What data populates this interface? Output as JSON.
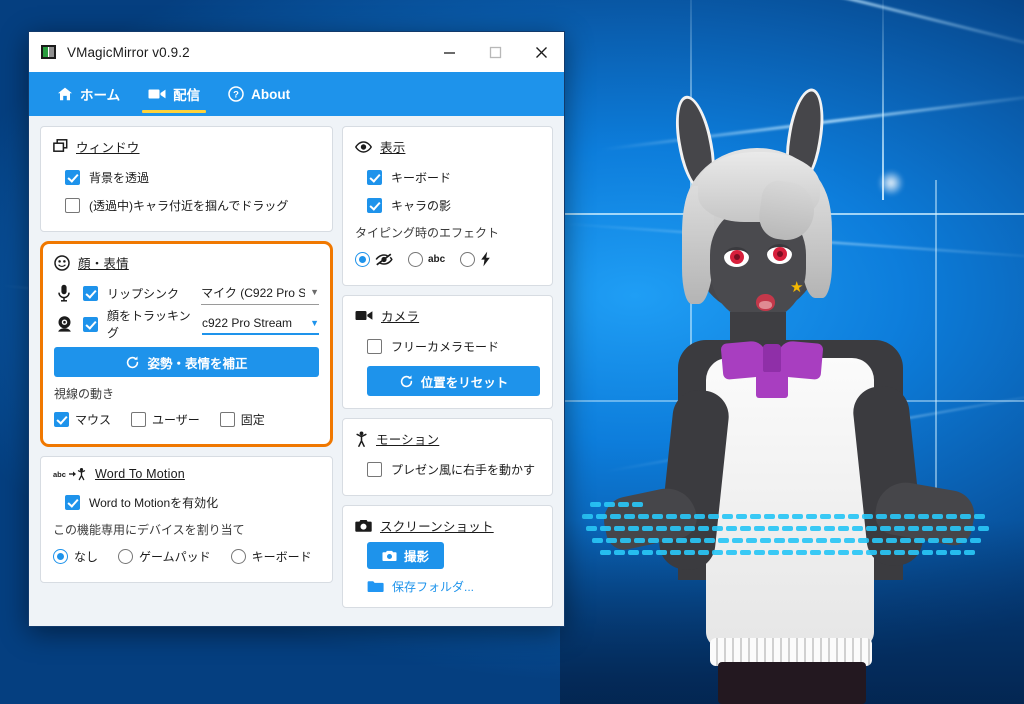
{
  "window": {
    "title": "VMagicMirror v0.9.2",
    "app_icon": "app-icon",
    "minimize_label": "—",
    "maximize_label": "□",
    "close_label": "✕"
  },
  "tabs": [
    {
      "label": "ホーム",
      "icon": "home-icon",
      "active": false
    },
    {
      "label": "配信",
      "icon": "video-camera-icon",
      "active": true
    },
    {
      "label": "About",
      "icon": "question-circle-icon",
      "active": false
    }
  ],
  "left_column": {
    "window_card": {
      "title": "ウィンドウ",
      "icon": "windows-overlap-icon",
      "options": [
        {
          "label": "背景を透過",
          "checked": true
        },
        {
          "label": "(透過中)キャラ付近を掴んでドラッグ",
          "checked": false
        }
      ]
    },
    "face_card": {
      "title": "顔・表情",
      "icon": "face-icon",
      "highlighted": true,
      "highlight_color": "#f07800",
      "lipsync": {
        "icon": "microphone-icon",
        "label": "リップシンク",
        "checked": true,
        "device": "マイク (C922 Pro S",
        "focused": false
      },
      "facetrack": {
        "icon": "webcam-icon",
        "label": "顔をトラッキング",
        "checked": true,
        "device": "c922 Pro Stream",
        "focused": true
      },
      "calibrate_button": {
        "label": "姿勢・表情を補正",
        "icon": "refresh-icon"
      },
      "gaze": {
        "label": "視線の動き",
        "options": [
          {
            "label": "マウス",
            "checked": true
          },
          {
            "label": "ユーザー",
            "checked": false
          },
          {
            "label": "固定",
            "checked": false
          }
        ]
      }
    },
    "word_to_motion_card": {
      "title": "Word To Motion",
      "icon": "abc-to-person-icon",
      "enable": {
        "label": "Word to Motionを有効化",
        "checked": true
      },
      "device_label": "この機能専用にデバイスを割り当て",
      "device_options": [
        {
          "label": "なし",
          "selected": true
        },
        {
          "label": "ゲームパッド",
          "selected": false
        },
        {
          "label": "キーボード",
          "selected": false
        }
      ]
    }
  },
  "right_column": {
    "display_card": {
      "title": "表示",
      "icon": "eye-icon",
      "options": [
        {
          "label": "キーボード",
          "checked": true
        },
        {
          "label": "キャラの影",
          "checked": true
        }
      ],
      "typing_effect_label": "タイピング時のエフェクト",
      "typing_effects": [
        {
          "icon": "eye-off-icon",
          "label": "",
          "selected": true
        },
        {
          "icon": "abc-text-icon",
          "label": "abc",
          "selected": false
        },
        {
          "icon": "lightning-bolt-icon",
          "label": "",
          "selected": false
        }
      ]
    },
    "camera_card": {
      "title": "カメラ",
      "icon": "video-camera-icon",
      "free_camera": {
        "label": "フリーカメラモード",
        "checked": false
      },
      "reset_button": {
        "label": "位置をリセット",
        "icon": "refresh-icon"
      }
    },
    "motion_card": {
      "title": "モーション",
      "icon": "person-icon",
      "option": {
        "label": "プレゼン風に右手を動かす",
        "checked": false
      }
    },
    "screenshot_card": {
      "title": "スクリーンショット",
      "icon": "camera-icon",
      "capture_button": {
        "label": "撮影",
        "icon": "camera-icon"
      },
      "folder_link": {
        "label": "保存フォルダ...",
        "icon": "folder-icon"
      }
    }
  },
  "colors": {
    "accent_blue": "#1e93eb",
    "highlight_orange": "#f07800",
    "tab_underline": "#ffd23a",
    "keyboard_effect_cyan": "#29c6f5"
  },
  "desktop": {
    "wallpaper": "windows-10-blue-light-wallpaper",
    "avatar": "vroid-bunny-avatar"
  }
}
